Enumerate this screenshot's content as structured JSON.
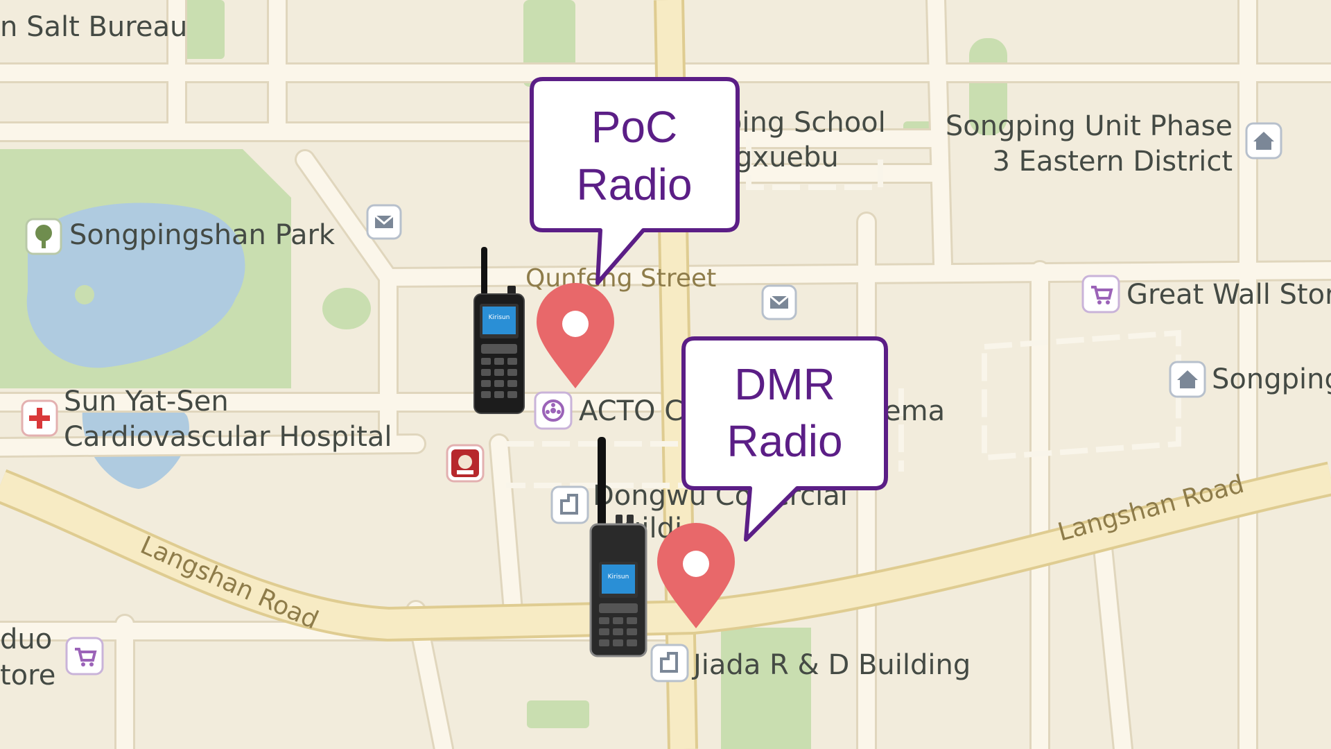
{
  "map": {
    "colors": {
      "land": "#f2ecdc",
      "road": "#fbf6ea",
      "road_edge": "#e0d6bd",
      "main_road": "#f7ebc4",
      "main_road_edge": "#dfcc91",
      "park": "#c9deb0",
      "water": "#afcbe0",
      "pin": "#e8686a",
      "callout_border": "#5b1e86",
      "callout_text": "#5b1e86"
    },
    "places": {
      "salt_bureau": "n Salt Bureau",
      "songpingshan_park": "Songpingshan Park",
      "hospital_line1": "Sun Yat-Sen",
      "hospital_line2": "Cardiovascular Hospital",
      "school_line1": "ping School",
      "school_line2": "gxuebu",
      "songping_unit_line1": "Songping Unit Phase",
      "songping_unit_line2": "3 Eastern District",
      "great_wall_store": "Great Wall Stor",
      "songping_right": "Songping",
      "acto_cinema_left": "ACTO C",
      "acto_cinema_right": "ema",
      "dongwu_line1": "Dongwu Co",
      "dongwu_line1b": "mercial",
      "dongwu_line2": "uildi",
      "jiada": "Jiada R & D Building",
      "duo_store_line1": "duo",
      "duo_store_line2": "tore"
    },
    "streets": {
      "qunfeng": "Qunfeng Street",
      "langshan_left": "Langshan Road",
      "langshan_right": "Langshan Road"
    },
    "icons": {
      "park": "tree-icon",
      "hospital": "hospital-cross-icon",
      "mail1": "mail-icon",
      "mail2": "mail-icon",
      "home1": "home-icon",
      "home2": "home-icon",
      "store1": "shopping-cart-icon",
      "store2": "shopping-cart-icon",
      "cinema": "film-reel-icon",
      "building1": "building-icon",
      "building2": "building-icon",
      "kfc": "restaurant-logo-icon"
    }
  },
  "callouts": {
    "poc": {
      "line1": "PoC",
      "line2": "Radio"
    },
    "dmr": {
      "line1": "DMR",
      "line2": "Radio"
    }
  },
  "radios": {
    "poc_brand": "Kirisun",
    "dmr_brand": "Kirisun"
  }
}
